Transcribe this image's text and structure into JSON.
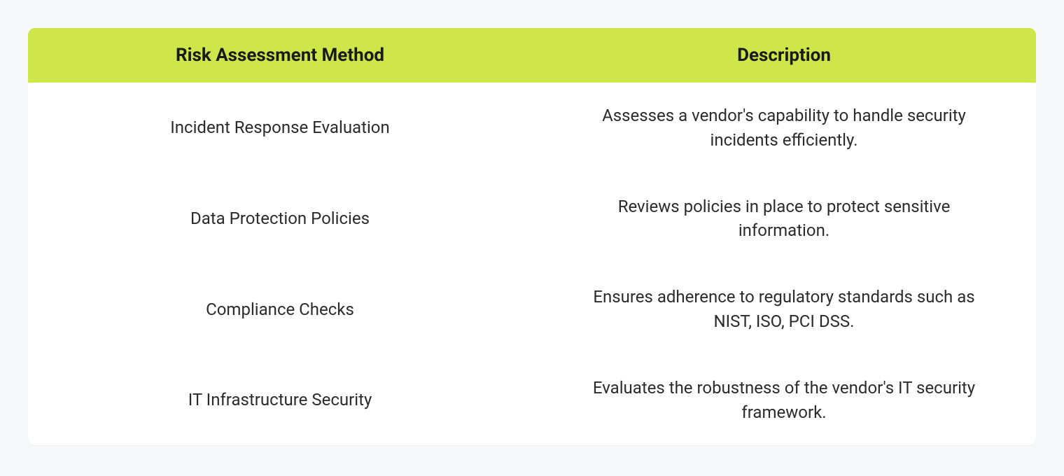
{
  "chart_data": {
    "type": "table",
    "columns": [
      "Risk Assessment Method",
      "Description"
    ],
    "rows": [
      [
        "Incident Response Evaluation",
        "Assesses a vendor's capability to handle security incidents efficiently."
      ],
      [
        "Data Protection Policies",
        "Reviews policies in place to protect sensitive information."
      ],
      [
        "Compliance Checks",
        "Ensures adherence to regulatory standards such as NIST, ISO, PCI DSS."
      ],
      [
        "IT Infrastructure Security",
        "Evaluates the robustness of the vendor's IT security framework."
      ]
    ]
  },
  "table": {
    "headers": {
      "method": "Risk Assessment Method",
      "description": "Description"
    },
    "rows": [
      {
        "method": "Incident Response Evaluation",
        "description": "Assesses a vendor's capability to handle security incidents efficiently."
      },
      {
        "method": "Data Protection Policies",
        "description": "Reviews policies in place to protect sensitive information."
      },
      {
        "method": "Compliance Checks",
        "description": "Ensures adherence to regulatory standards such as NIST, ISO, PCI DSS."
      },
      {
        "method": "IT Infrastructure Security",
        "description": "Evaluates the robustness of the vendor's IT security framework."
      }
    ]
  }
}
